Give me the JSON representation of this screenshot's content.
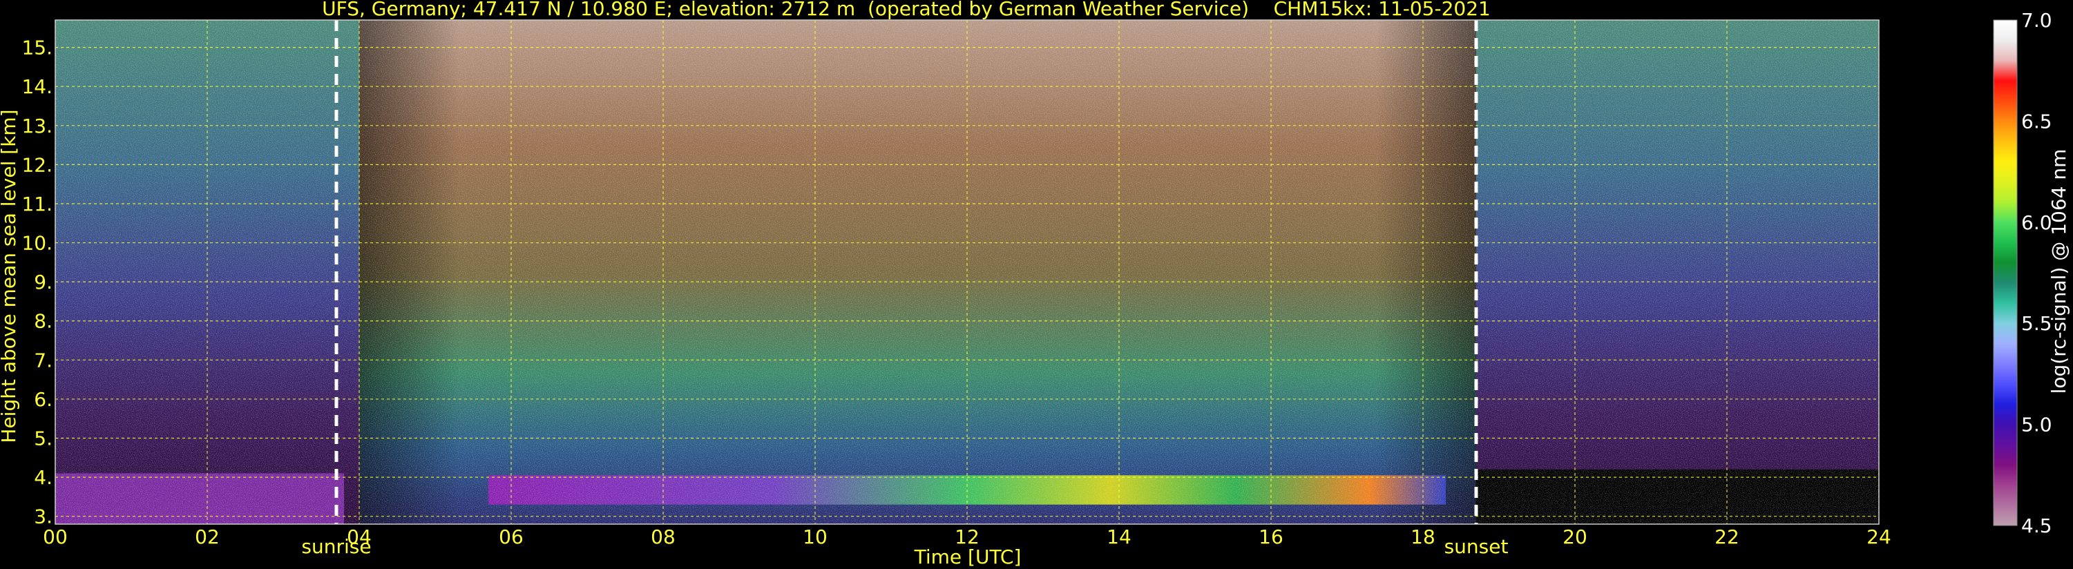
{
  "chart_data": {
    "type": "heatmap",
    "title": "UFS, Germany; 47.417 N / 10.980 E; elevation: 2712 m  (operated by German Weather Service)    CHM15kx: 11-05-2021",
    "xlabel": "Time [UTC]",
    "ylabel": "Height above mean sea level [km]",
    "xlim": [
      0,
      24
    ],
    "ylim": [
      2.8,
      15.7
    ],
    "x_ticks": [
      "00",
      "02",
      "04",
      "06",
      "08",
      "10",
      "12",
      "14",
      "16",
      "18",
      "20",
      "22",
      "24"
    ],
    "y_ticks": [
      "3.",
      "4.",
      "5.",
      "6.",
      "7.",
      "8.",
      "9.",
      "10.",
      "11.",
      "12.",
      "13.",
      "14.",
      "15."
    ],
    "grid": true,
    "markers": [
      {
        "label": "sunrise",
        "x": 3.7
      },
      {
        "label": "sunset",
        "x": 18.7
      }
    ],
    "colorbar": {
      "label": "log(rc-signal) @ 1064 nm",
      "range": [
        4.5,
        7.0
      ],
      "ticks": [
        "7.0",
        "6.5",
        "6.0",
        "5.5",
        "5.0",
        "4.5"
      ]
    },
    "colors": {
      "axis_text": "#ffff33",
      "grid": "#ffff33",
      "background": "#000000",
      "marker_line": "#ffffff"
    }
  }
}
